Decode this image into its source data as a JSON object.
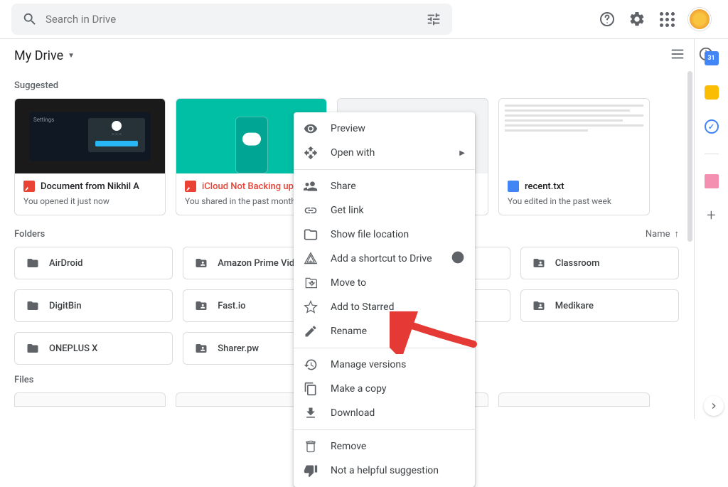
{
  "search": {
    "placeholder": "Search in Drive"
  },
  "breadcrumb": {
    "title": "My Drive"
  },
  "sections": {
    "suggested": "Suggested",
    "folders": "Folders",
    "files": "Files",
    "name": "Name"
  },
  "suggested_cards": [
    {
      "title": "Document from Nikhil A",
      "subtitle": "You opened it just now",
      "type": "image"
    },
    {
      "title": "iCloud Not Backing up P",
      "subtitle": "You shared in the past month",
      "type": "image"
    },
    {
      "title": "",
      "subtitle": "",
      "type": "hidden"
    },
    {
      "title": "recent.txt",
      "subtitle": "You edited in the past week",
      "type": "doc"
    }
  ],
  "folders": [
    {
      "name": "AirDroid",
      "shared": false
    },
    {
      "name": "Amazon Prime Video",
      "shared": true
    },
    {
      "name": "",
      "shared": false
    },
    {
      "name": "Classroom",
      "shared": true
    },
    {
      "name": "DigitBin",
      "shared": false
    },
    {
      "name": "Fast.io",
      "shared": true
    },
    {
      "name": "",
      "shared": false
    },
    {
      "name": "Medikare",
      "shared": true
    },
    {
      "name": "ONEPLUS X",
      "shared": false
    },
    {
      "name": "Sharer.pw",
      "shared": true
    }
  ],
  "context_menu": {
    "preview": "Preview",
    "open_with": "Open with",
    "share": "Share",
    "get_link": "Get link",
    "show_location": "Show file location",
    "add_shortcut": "Add a shortcut to Drive",
    "move_to": "Move to",
    "add_starred": "Add to Starred",
    "rename": "Rename",
    "manage_versions": "Manage versions",
    "make_copy": "Make a copy",
    "download": "Download",
    "remove": "Remove",
    "not_helpful": "Not a helpful suggestion"
  }
}
